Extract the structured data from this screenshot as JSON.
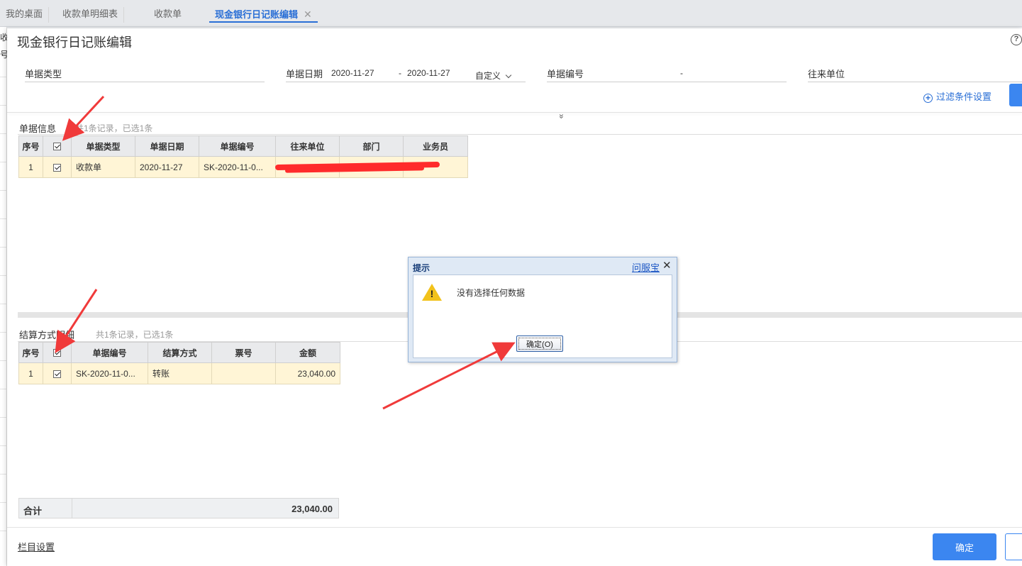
{
  "tabs": [
    {
      "label": "我的桌面"
    },
    {
      "label": "收款单明细表"
    },
    {
      "label": "收款单"
    },
    {
      "label": "现金银行日记账编辑",
      "close": "✕"
    }
  ],
  "left_behind": {
    "t1": "收",
    "t2": "号"
  },
  "dialog": {
    "title": "现金银行日记账编辑",
    "help_icon": "?",
    "filters": {
      "bill_type": {
        "label": "单据类型"
      },
      "bill_date": {
        "label": "单据日期",
        "from": "2020-11-27",
        "sep": "-",
        "to": "2020-11-27",
        "range": "自定义"
      },
      "bill_no": {
        "label": "单据编号",
        "sep": "-"
      },
      "partner": {
        "label": "往来单位"
      }
    },
    "filter_settings_label": "过滤条件设置",
    "expand_icon": "»"
  },
  "bill_info": {
    "label": "单据信息",
    "meta": "共1条记录，已选1条",
    "columns": [
      "序号",
      "",
      "单据类型",
      "单据日期",
      "单据编号",
      "往来单位",
      "部门",
      "业务员"
    ],
    "rows": [
      {
        "seq": "1",
        "type": "收款单",
        "date": "2020-11-27",
        "no": "SK-2020-11-0...",
        "partner": "",
        "dept": "",
        "staff": ""
      }
    ]
  },
  "settle_detail": {
    "label": "结算方式明细",
    "meta": "共1条记录，已选1条",
    "columns": [
      "序号",
      "",
      "单据编号",
      "结算方式",
      "票号",
      "金额"
    ],
    "rows": [
      {
        "seq": "1",
        "no": "SK-2020-11-0...",
        "method": "转账",
        "ticket": "",
        "amount": "23,040.00"
      }
    ],
    "total_label": "合计",
    "total_amount": "23,040.00"
  },
  "footer": {
    "column_settings": "栏目设置",
    "ok_label": "确定"
  },
  "modal": {
    "title": "提示",
    "help_link": "问服宝",
    "close": "✕",
    "message": "没有选择任何数据",
    "ok_label": "确定(O)"
  },
  "colors": {
    "accent": "#3b86f0",
    "row_selected": "#fff5d6",
    "annotation_arrow": "#f03a3a",
    "redaction": "#ff2b2b"
  }
}
